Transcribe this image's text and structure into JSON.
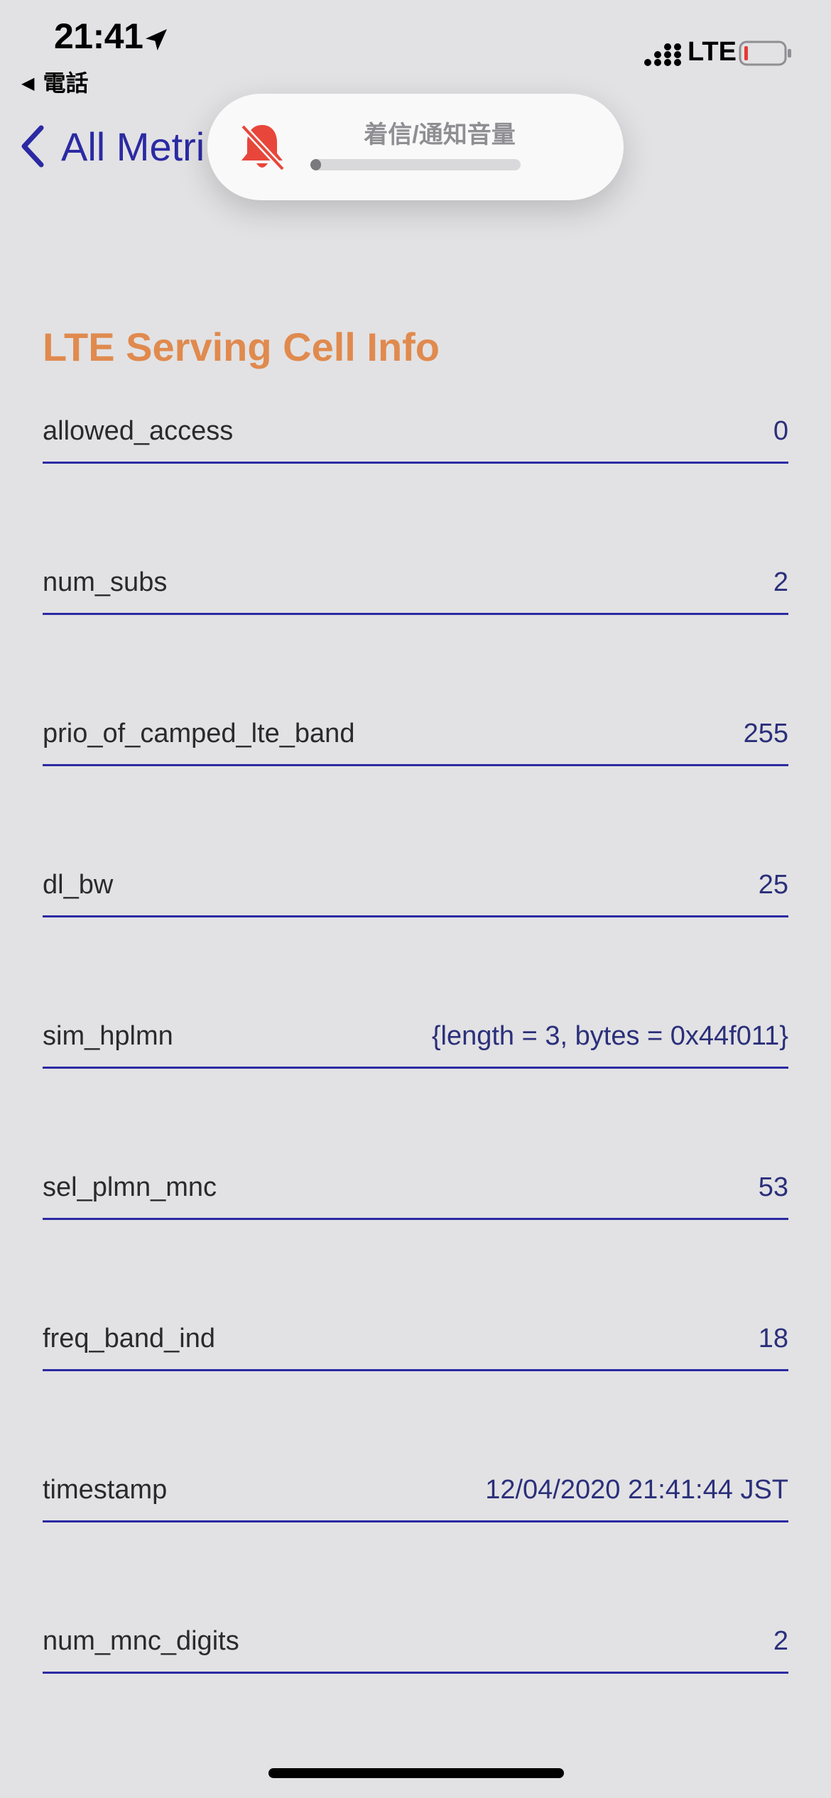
{
  "status_bar": {
    "time": "21:41",
    "back_app": "電話",
    "network": "LTE",
    "icons": [
      "location-arrow-icon",
      "signal-icon",
      "battery-low-icon"
    ],
    "battery_color": "#e53935"
  },
  "nav": {
    "back_label": "All Metri",
    "accent_color": "#2b2aa3"
  },
  "volume_hud": {
    "title": "着信/通知音量",
    "icon": "bell-slash-icon",
    "icon_color": "#e8463a",
    "level": 0.05
  },
  "section": {
    "title": "LTE Serving Cell Info",
    "title_color": "#e08a4e",
    "rows": [
      {
        "label": "allowed_access",
        "value": "0"
      },
      {
        "label": "num_subs",
        "value": "2"
      },
      {
        "label": "prio_of_camped_lte_band",
        "value": "255"
      },
      {
        "label": "dl_bw",
        "value": "25"
      },
      {
        "label": "sim_hplmn",
        "value": "{length = 3, bytes = 0x44f011}"
      },
      {
        "label": "sel_plmn_mnc",
        "value": "53"
      },
      {
        "label": "freq_band_ind",
        "value": "18"
      },
      {
        "label": "timestamp",
        "value": "12/04/2020 21:41:44 JST"
      },
      {
        "label": "num_mnc_digits",
        "value": "2"
      }
    ]
  }
}
